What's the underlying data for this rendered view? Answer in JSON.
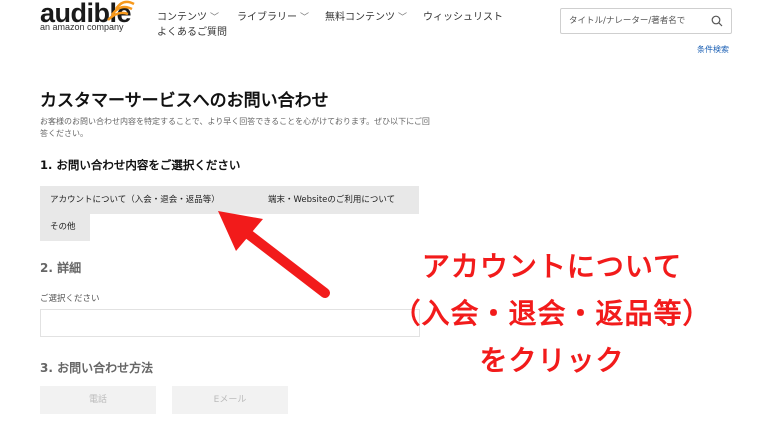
{
  "header": {
    "logo_text": "audible",
    "logo_subtext": "an amazon company",
    "nav": {
      "contents": "コンテンツ",
      "library": "ライブラリー",
      "free_contents": "無料コンテンツ",
      "wishlist": "ウィッシュリスト",
      "faq": "よくあるご質問"
    },
    "search_placeholder": "タイトル/ナレーター/著者名で",
    "advanced_search": "条件検索"
  },
  "page": {
    "title": "カスタマーサービスへのお問い合わせ",
    "description": "お客様のお問い合わせ内容を特定することで、より早く回答できることを心がけております。ぜひ以下にご回答ください。",
    "step1": {
      "heading": "1. お問い合わせ内容をご選択ください",
      "options": [
        "アカウントについて（入会・退会・返品等）",
        "端末・Websiteのご利用について",
        "その他"
      ]
    },
    "step2": {
      "heading": "2.  詳細",
      "select_label": "ご選択ください",
      "select_value": ""
    },
    "step3": {
      "heading": "3.  お問い合わせ方法",
      "methods": [
        "電話",
        "Eメール"
      ]
    }
  },
  "annotation": {
    "line1": "アカウントについて",
    "line2": "（入会・退会・返品等）",
    "line3": "をクリック",
    "color": "#f21b1b"
  },
  "colors": {
    "logo_orange": "#f7991c",
    "link_blue": "#1a5fb4",
    "chip_bg": "#e8e8e8"
  }
}
